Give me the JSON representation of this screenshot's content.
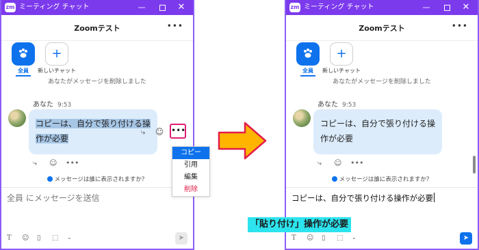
{
  "window_title": "ミーティング チャット",
  "app_logo": "zm",
  "chat_title": "Zoomテスト",
  "more_icon": "more-horizontal-icon",
  "quick_actions": {
    "all_label": "全員",
    "new_chat_label": "新しいチャット"
  },
  "system_message": "あなたがメッセージを削除しました",
  "sender": "あなた",
  "time": "9:53",
  "message": {
    "line1": "コピーは、自分で張り付ける操",
    "line2": "作が必要"
  },
  "context_menu": [
    {
      "label": "コピー",
      "state": "selected"
    },
    {
      "label": "引用",
      "state": "normal"
    },
    {
      "label": "編集",
      "state": "normal"
    },
    {
      "label": "削除",
      "state": "danger"
    }
  ],
  "visibility_note": "メッセージは誰に表示されますか？",
  "compose_placeholder": "全員 にメッセージを送信",
  "compose_value": "コピーは、自分で張り付ける操作が必要",
  "caption": "「貼り付け」操作が必要",
  "colors": {
    "titlebar": "#7c3aed",
    "accent": "#0e72ed",
    "bubble": "#dcecfb",
    "highlight": "#a7c6e6",
    "menu_border": "#e11d74",
    "arrow_fill": "#ffb400",
    "arrow_stroke": "#e11d48",
    "caption_bg": "#2ce3ee"
  }
}
